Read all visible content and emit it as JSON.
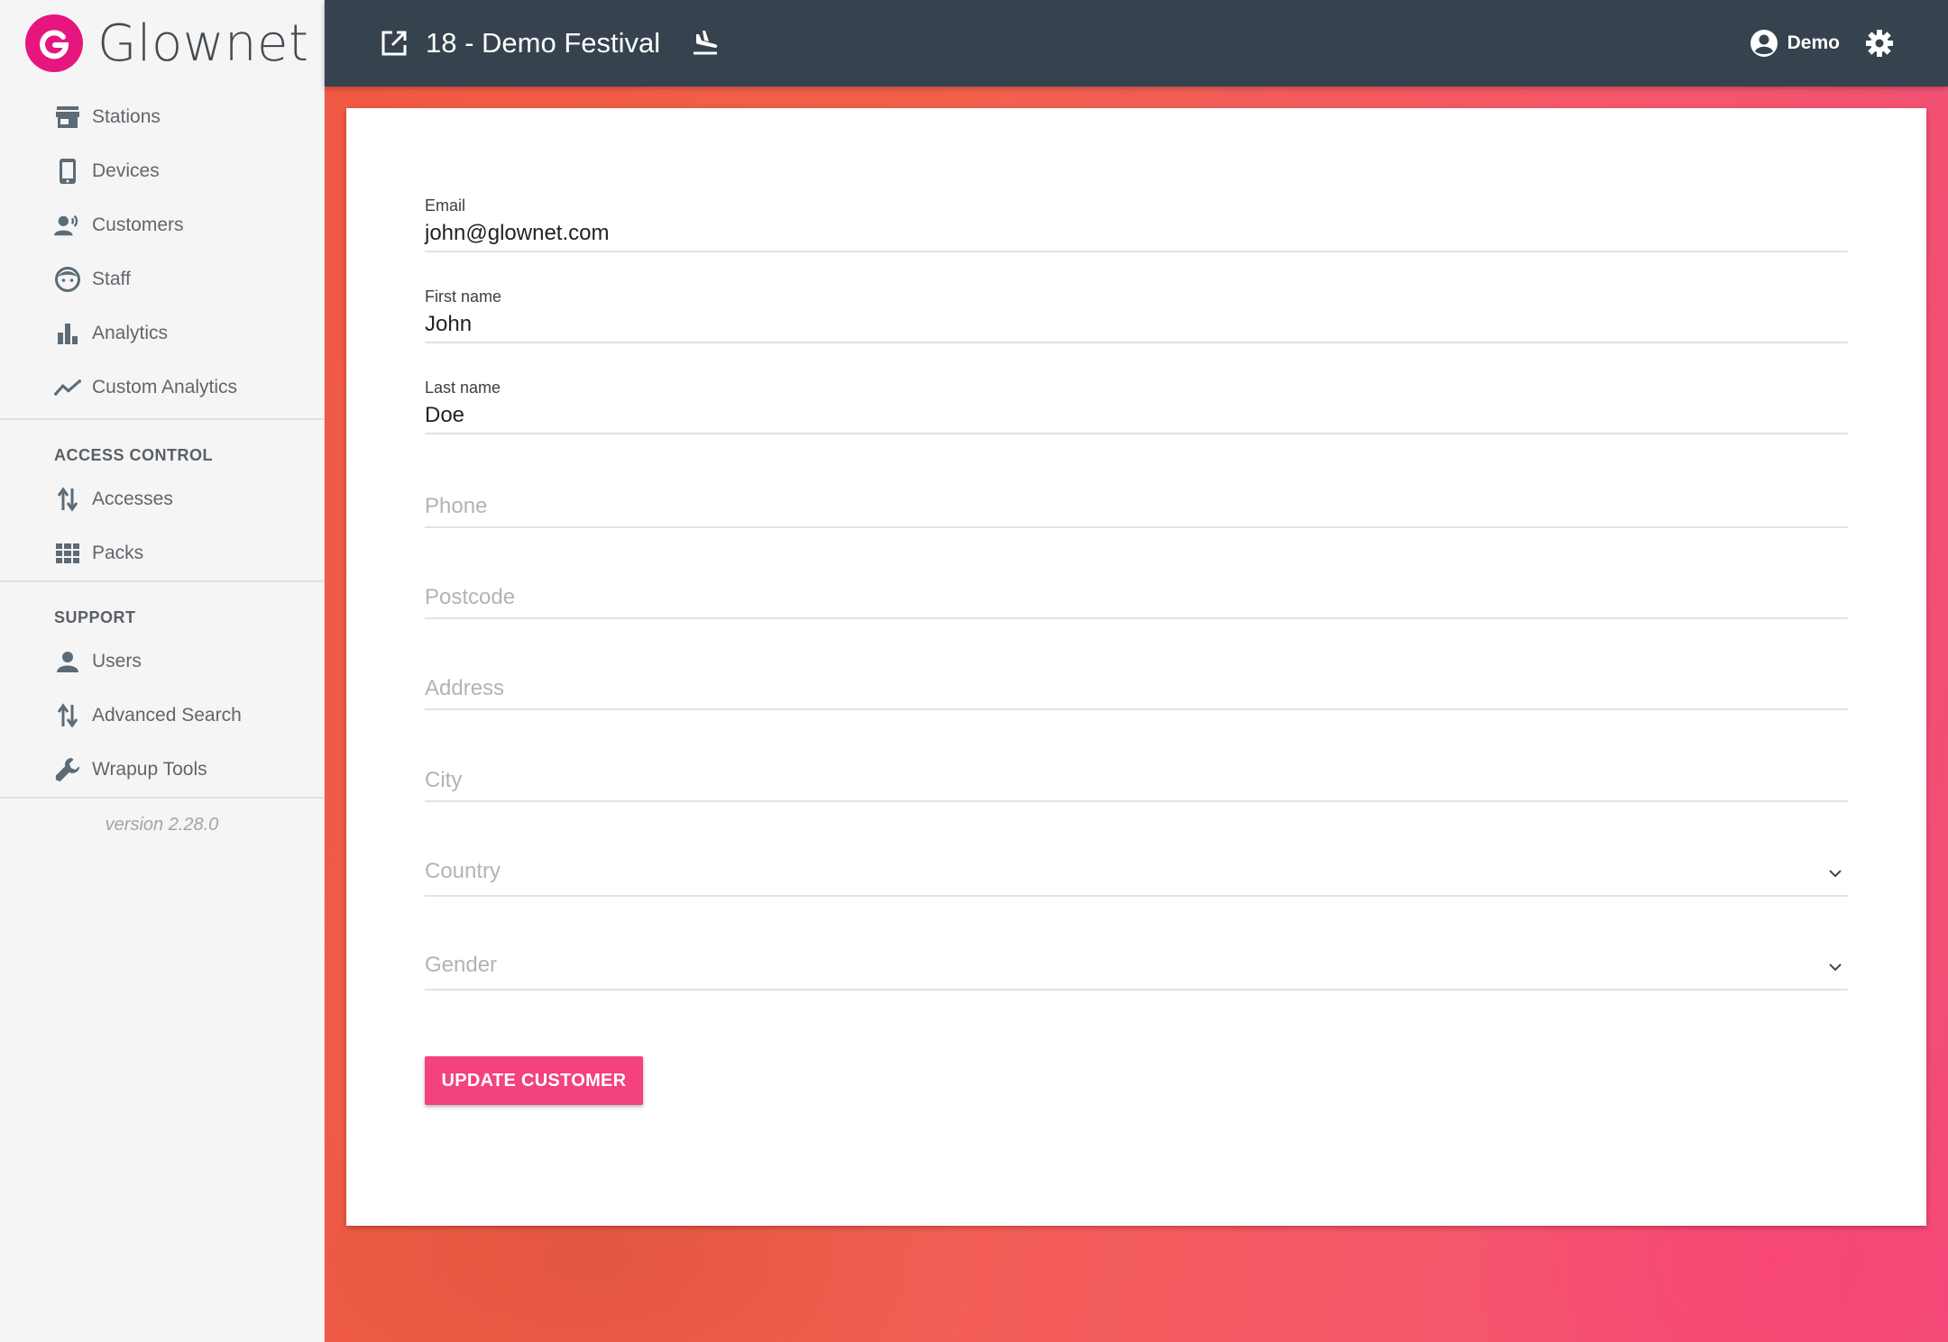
{
  "brand": {
    "name": "Glownet"
  },
  "sidebar": {
    "main_items": [
      {
        "label": "Stations",
        "icon": "store-icon"
      },
      {
        "label": "Devices",
        "icon": "phone-icon"
      },
      {
        "label": "Customers",
        "icon": "customers-icon"
      },
      {
        "label": "Staff",
        "icon": "face-icon"
      },
      {
        "label": "Analytics",
        "icon": "bar-chart-icon"
      },
      {
        "label": "Custom Analytics",
        "icon": "trend-line-icon"
      }
    ],
    "access_control": {
      "title": "ACCESS CONTROL",
      "items": [
        {
          "label": "Accesses",
          "icon": "swap-vertical-icon"
        },
        {
          "label": "Packs",
          "icon": "grid-icon"
        }
      ]
    },
    "support": {
      "title": "SUPPORT",
      "items": [
        {
          "label": "Users",
          "icon": "person-icon"
        },
        {
          "label": "Advanced Search",
          "icon": "swap-vertical-icon"
        },
        {
          "label": "Wrapup Tools",
          "icon": "wrench-icon"
        }
      ]
    },
    "version": "version 2.28.0"
  },
  "header": {
    "event_title": "18 - Demo Festival",
    "user_name": "Demo"
  },
  "form": {
    "email": {
      "label": "Email",
      "value": "john@glownet.com"
    },
    "first_name": {
      "label": "First name",
      "value": "John"
    },
    "last_name": {
      "label": "Last name",
      "value": "Doe"
    },
    "phone": {
      "placeholder": "Phone"
    },
    "postcode": {
      "placeholder": "Postcode"
    },
    "address": {
      "placeholder": "Address"
    },
    "city": {
      "placeholder": "City"
    },
    "country": {
      "placeholder": "Country"
    },
    "gender": {
      "placeholder": "Gender"
    },
    "submit_label": "UPDATE CUSTOMER"
  },
  "colors": {
    "header_bg": "#36434e",
    "brand_pink": "#e6167e",
    "button_pink": "#f4417f",
    "sidebar_bg": "#f5f5f5"
  }
}
